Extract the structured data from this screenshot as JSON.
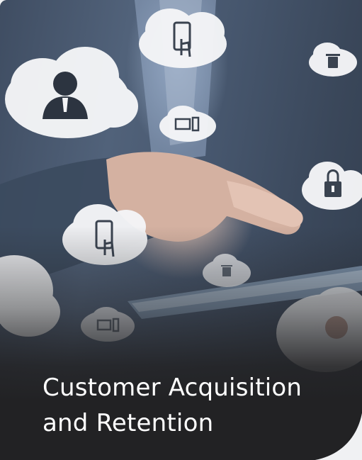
{
  "card": {
    "title_line1": "Customer Acquisition",
    "title_line2": "and Retention"
  },
  "colors": {
    "caption_background": "#222224",
    "caption_text": "#ffffff",
    "page_background": "#f0f1f3"
  },
  "icons": [
    "person-cloud-icon",
    "phone-touch-cloud-icon",
    "trash-cloud-icon",
    "computer-cloud-icon",
    "lock-cloud-icon"
  ]
}
